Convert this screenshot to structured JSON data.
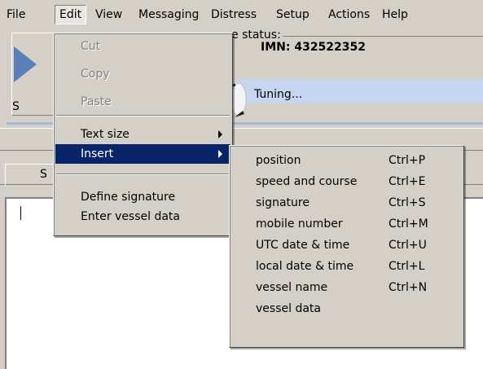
{
  "menubar": {
    "items": [
      "File",
      "Edit",
      "View",
      "Messaging",
      "Distress",
      "Setup",
      "Actions",
      "Help"
    ]
  },
  "background": {
    "group_title": "e status:",
    "imn_text": "IMN: 432522352",
    "tuning_text": "Tuning...",
    "send_label": "S",
    "tab_label": "S"
  },
  "edit_menu": {
    "items": [
      {
        "label": "Cut",
        "enabled": false
      },
      {
        "label": "Copy",
        "enabled": false
      },
      {
        "label": "Paste",
        "enabled": false
      },
      {
        "label": "Text size",
        "submenu": true
      },
      {
        "label": "Insert",
        "submenu": true,
        "highlighted": true
      },
      {
        "label": "Define signature"
      },
      {
        "label": "Enter vessel data"
      }
    ]
  },
  "insert_menu": {
    "items": [
      {
        "label": "position",
        "shortcut": "Ctrl+P"
      },
      {
        "label": "speed and course",
        "shortcut": "Ctrl+E"
      },
      {
        "label": "signature",
        "shortcut": "Ctrl+S"
      },
      {
        "label": "mobile number",
        "shortcut": "Ctrl+M"
      },
      {
        "label": "UTC date & time",
        "shortcut": "Ctrl+U"
      },
      {
        "label": "local date & time",
        "shortcut": "Ctrl+L"
      },
      {
        "label": "vessel name",
        "shortcut": "Ctrl+N"
      },
      {
        "label": "vessel data",
        "shortcut": ""
      }
    ]
  },
  "colors": {
    "highlight": "#0a246a",
    "face": "#d4d0c8",
    "info_bar": "#c6d6f0"
  }
}
